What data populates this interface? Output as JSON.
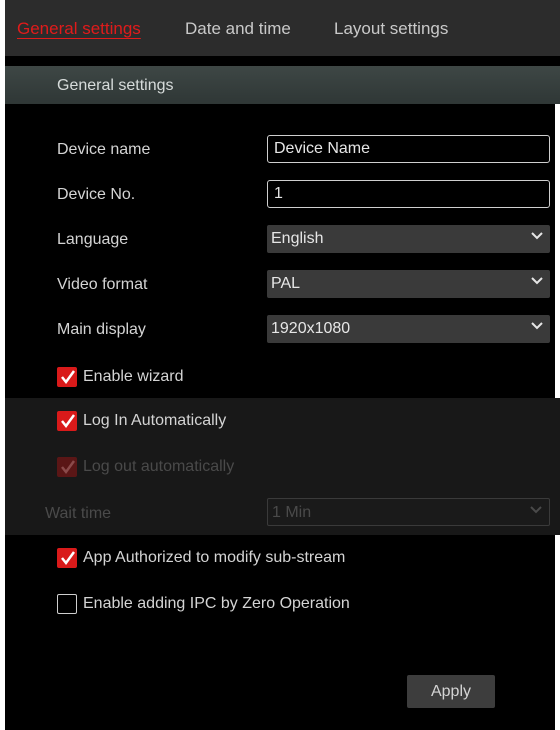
{
  "tabs": [
    {
      "label": "General settings",
      "active": true
    },
    {
      "label": "Date and time",
      "active": false
    },
    {
      "label": "Layout settings",
      "active": false
    }
  ],
  "section": {
    "title": "General settings"
  },
  "form": {
    "device_name": {
      "label": "Device name",
      "value": "Device Name"
    },
    "device_no": {
      "label": "Device No.",
      "value": "1"
    },
    "language": {
      "label": "Language",
      "value": "English"
    },
    "video_format": {
      "label": "Video format",
      "value": "PAL"
    },
    "main_display": {
      "label": "Main display",
      "value": "1920x1080"
    },
    "enable_wizard": {
      "label": "Enable wizard",
      "checked": true
    },
    "log_in_auto": {
      "label": "Log In Automatically",
      "checked": true
    },
    "log_out_auto": {
      "label": "Log out automatically",
      "checked": true,
      "disabled": true
    },
    "wait_time": {
      "label": "Wait time",
      "value": "1 Min",
      "disabled": true
    },
    "app_authorized": {
      "label": "App Authorized to modify sub-stream",
      "checked": true
    },
    "zero_operation": {
      "label": "Enable adding IPC by Zero Operation",
      "checked": false
    }
  },
  "apply_label": "Apply",
  "colors": {
    "accent": "#d91a1a",
    "background": "#000000",
    "tabbar": "#2c2c2c"
  }
}
